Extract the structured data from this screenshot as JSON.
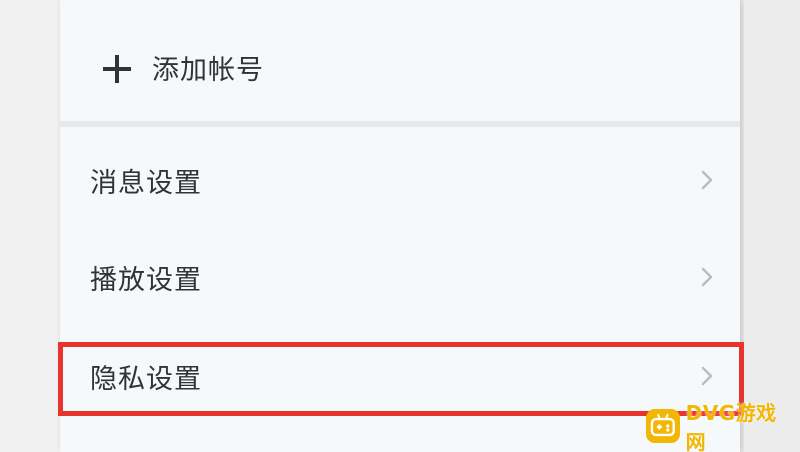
{
  "account": {
    "add_label": "添加帐号"
  },
  "settings": {
    "items": [
      {
        "label": "消息设置"
      },
      {
        "label": "播放设置"
      },
      {
        "label": "隐私设置"
      }
    ]
  },
  "watermark": {
    "text": "DVG游戏网"
  },
  "colors": {
    "highlight_border": "#e8342f",
    "panel_bg": "#f6f9fc",
    "text": "#333333",
    "watermark": "#f2b705"
  }
}
